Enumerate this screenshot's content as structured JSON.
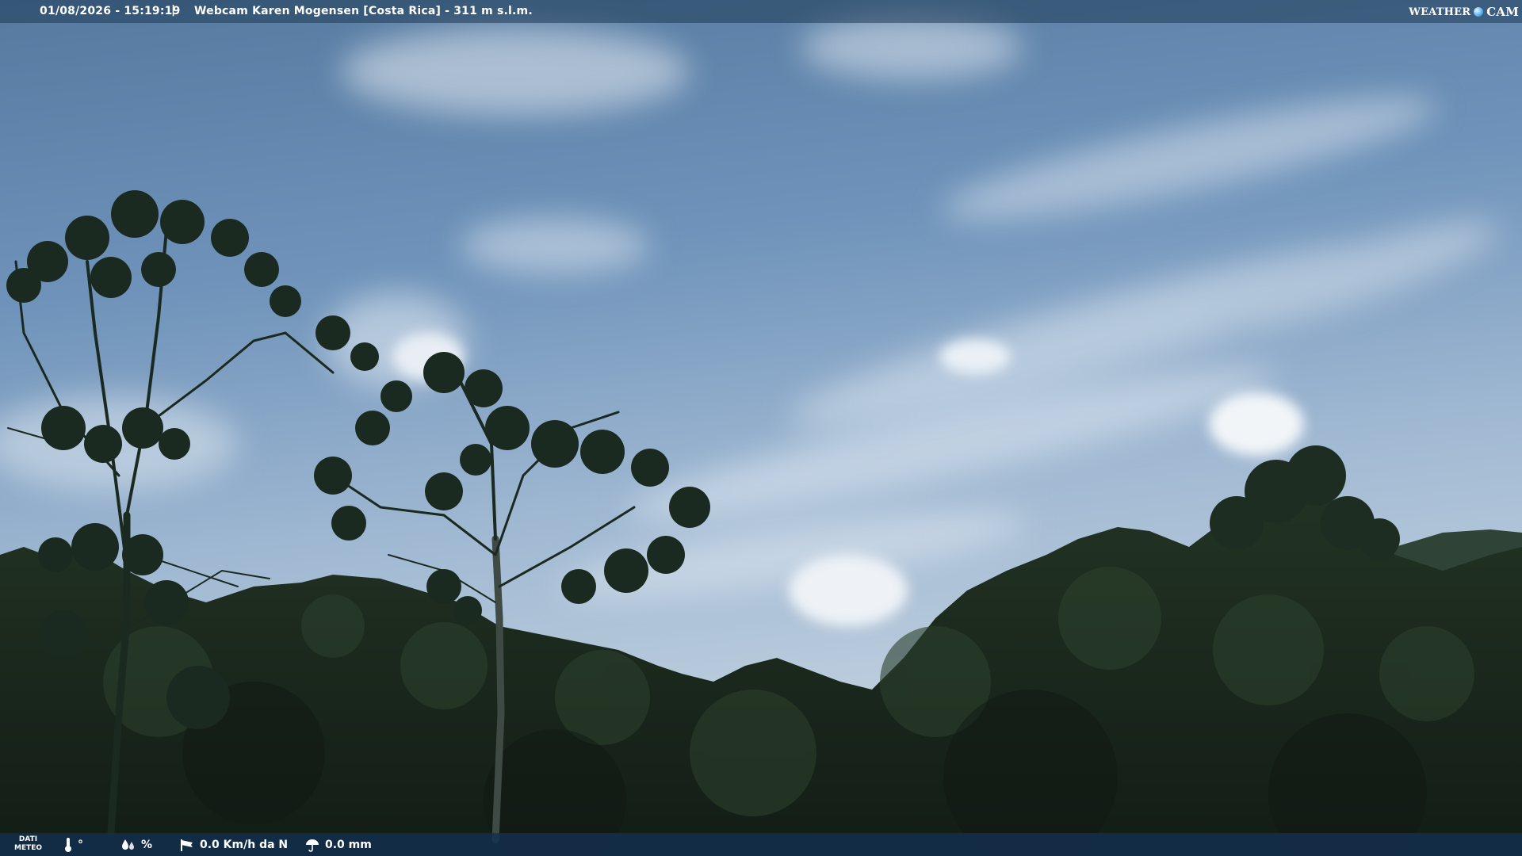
{
  "overlay": {
    "datetime": "01/08/2026 - 15:19:19",
    "separator": "|",
    "title": "Webcam Karen Mogensen [Costa Rica] - 311 m s.l.m.",
    "logo": {
      "word1": "WEATHER",
      "word2": "CAM"
    }
  },
  "weather": {
    "label_line1": "DATI",
    "label_line2": "METEO",
    "temperature_unit": "°",
    "humidity_unit": "%",
    "wind": "0.0 Km/h da N",
    "rain": "0.0 mm"
  },
  "colors": {
    "sky_top": "#5a7ea8",
    "sky_mid": "#8aa9c9",
    "sky_low": "#c8d6e4",
    "forest": "#1a2a1f",
    "bar": "#1e3a56"
  }
}
